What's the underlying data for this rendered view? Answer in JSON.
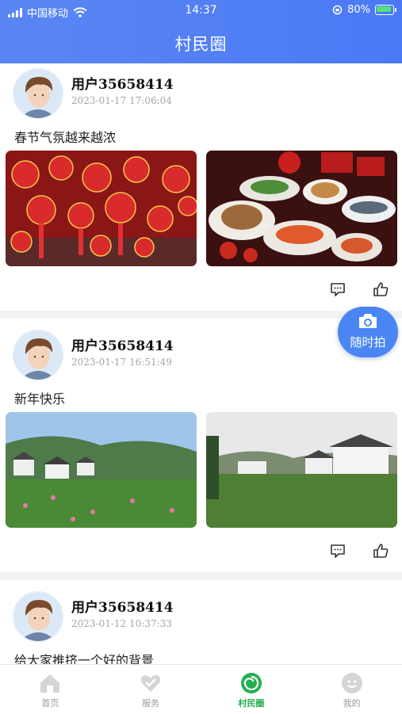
{
  "status_bar": {
    "carrier": "中国移动",
    "time": "14:37",
    "battery": "80%"
  },
  "nav": {
    "title": "村民圈"
  },
  "posts": [
    {
      "username": "用户35658414",
      "time": "2023-01-17 17:06:04",
      "text": "春节气氛越来越浓"
    },
    {
      "username": "用户35658414",
      "time": "2023-01-17 16:51:49",
      "text": "新年快乐"
    },
    {
      "username": "用户35658414",
      "time": "2023-01-12 10:37:33",
      "text": "给大家推挤一个好的背景"
    }
  ],
  "fab": {
    "label": "随时拍",
    "icon": "camera-icon"
  },
  "tabbar": {
    "items": [
      {
        "label": "首页",
        "icon": "home-icon"
      },
      {
        "label": "服务",
        "icon": "heart-hand-icon"
      },
      {
        "label": "村民圈",
        "icon": "swirl-icon"
      },
      {
        "label": "我的",
        "icon": "profile-icon"
      }
    ],
    "active": "村民圈"
  },
  "colors": {
    "header": "#4a79f5",
    "accent_green": "#23b04f",
    "fab": "#4a86f3"
  }
}
